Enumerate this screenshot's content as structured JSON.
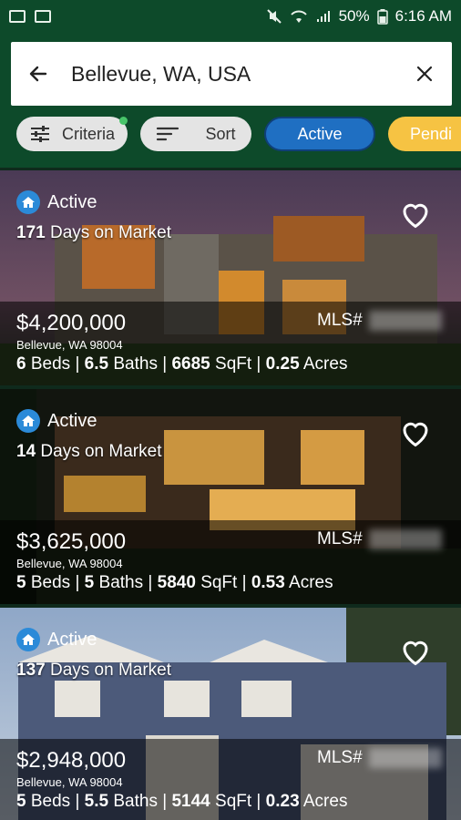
{
  "status_bar": {
    "battery": "50%",
    "time": "6:16 AM"
  },
  "search": {
    "value": "Bellevue, WA, USA"
  },
  "filters": {
    "criteria_label": "Criteria",
    "sort_label": "Sort",
    "active_label": "Active",
    "pending_label": "Pendi"
  },
  "listings": [
    {
      "status": "Active",
      "days_number": "171",
      "days_label": "Days on Market",
      "price": "$4,200,000",
      "mls_label": "MLS#",
      "address": "Bellevue, WA 98004",
      "beds": "6",
      "beds_label": "Beds",
      "baths": "6.5",
      "baths_label": "Baths",
      "sqft": "6685",
      "sqft_label": "SqFt",
      "acres": "0.25",
      "acres_label": "Acres"
    },
    {
      "status": "Active",
      "days_number": "14",
      "days_label": "Days on Market",
      "price": "$3,625,000",
      "mls_label": "MLS#",
      "address": "Bellevue, WA 98004",
      "beds": "5",
      "beds_label": "Beds",
      "baths": "5",
      "baths_label": "Baths",
      "sqft": "5840",
      "sqft_label": "SqFt",
      "acres": "0.53",
      "acres_label": "Acres"
    },
    {
      "status": "Active",
      "days_number": "137",
      "days_label": "Days on Market",
      "price": "$2,948,000",
      "mls_label": "MLS#",
      "address": "Bellevue, WA 98004",
      "beds": "5",
      "beds_label": "Beds",
      "baths": "5.5",
      "baths_label": "Baths",
      "sqft": "5144",
      "sqft_label": "SqFt",
      "acres": "0.23",
      "acres_label": "Acres"
    }
  ],
  "colors": {
    "header_green": "#0d4a2a",
    "active_blue": "#1f6fc2",
    "pending_yellow": "#f6c343"
  }
}
